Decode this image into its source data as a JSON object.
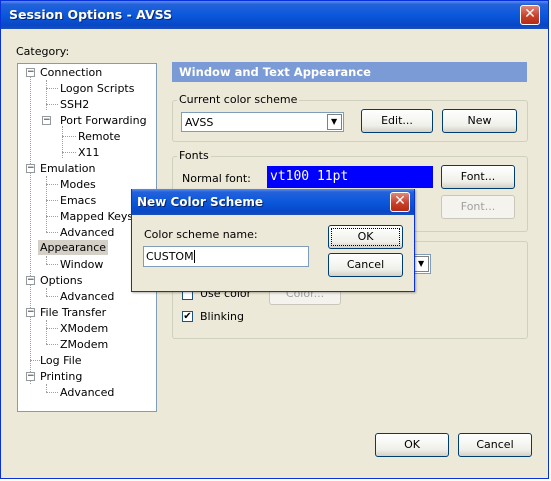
{
  "window": {
    "title": "Session Options - AVSS"
  },
  "category": {
    "label": "Category:",
    "items": [
      {
        "label": "Connection"
      },
      {
        "label": "Logon Scripts"
      },
      {
        "label": "SSH2"
      },
      {
        "label": "Port Forwarding"
      },
      {
        "label": "Remote"
      },
      {
        "label": "X11"
      },
      {
        "label": "Emulation"
      },
      {
        "label": "Modes"
      },
      {
        "label": "Emacs"
      },
      {
        "label": "Mapped Keys"
      },
      {
        "label": "Advanced"
      },
      {
        "label": "Appearance"
      },
      {
        "label": "Window"
      },
      {
        "label": "Options"
      },
      {
        "label": "Advanced"
      },
      {
        "label": "File Transfer"
      },
      {
        "label": "XModem"
      },
      {
        "label": "ZModem"
      },
      {
        "label": "Log File"
      },
      {
        "label": "Printing"
      },
      {
        "label": "Advanced"
      }
    ],
    "expander_symbol": "−"
  },
  "panel": {
    "header": "Window and Text Appearance",
    "color_scheme": {
      "group_label": "Current color scheme",
      "value": "AVSS",
      "edit_label": "Edit...",
      "new_label": "New"
    },
    "fonts": {
      "group_label": "Fonts",
      "normal_font_label": "Normal font:",
      "font_preview": "vt100 11pt",
      "font_button": "Font...",
      "font_button2": "Font..."
    },
    "use_color": {
      "label": "Use color",
      "button": "Color..."
    },
    "blinking": {
      "label": "Blinking",
      "checked": true
    }
  },
  "footer": {
    "ok_label": "OK",
    "cancel_label": "Cancel"
  },
  "dialog": {
    "title": "New Color Scheme",
    "name_label": "Color scheme name:",
    "name_value": "CUSTOM",
    "ok_label": "OK",
    "cancel_label": "Cancel"
  },
  "glyphs": {
    "close": "✕",
    "check": "✔",
    "dropdown": "▼"
  },
  "colors": {
    "title_blue": "#0a58dc",
    "panel_header": "#7b9bd6",
    "font_preview_bg": "#0000ff",
    "font_preview_fg": "#ffffff",
    "selection": "#d4d0c8"
  }
}
